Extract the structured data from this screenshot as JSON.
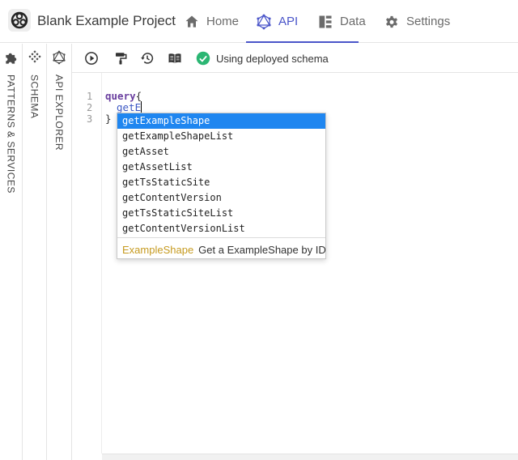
{
  "header": {
    "project_title": "Blank Example Project",
    "nav": [
      {
        "label": "Home",
        "icon": "home-icon"
      },
      {
        "label": "API",
        "icon": "graphql-icon",
        "active": true
      },
      {
        "label": "Data",
        "icon": "data-icon"
      },
      {
        "label": "Settings",
        "icon": "gear-icon"
      }
    ]
  },
  "sidebar": {
    "panels": [
      {
        "label": "PATTERNS & SERVICES",
        "icon": "puzzle-icon"
      },
      {
        "label": "SCHEMA",
        "icon": "schema-icon"
      },
      {
        "label": "API EXPLORER",
        "icon": "explorer-icon"
      }
    ]
  },
  "toolbar": {
    "status_text": "Using deployed schema"
  },
  "editor": {
    "line_numbers": [
      "1",
      "2",
      "3"
    ],
    "line1_keyword": "query",
    "line1_brace": "{",
    "line2_text": "getE",
    "line3_text": "}"
  },
  "autocomplete": {
    "items": [
      "getExampleShape",
      "getExampleShapeList",
      "getAsset",
      "getAssetList",
      "getTsStaticSite",
      "getContentVersion",
      "getTsStaticSiteList",
      "getContentVersionList"
    ],
    "detail_type": "ExampleShape",
    "detail_desc": "Get a ExampleShape by ID"
  },
  "colors": {
    "accent": "#4a55c9",
    "selection": "#1f86f0",
    "status_ok": "#2bb673",
    "type_color": "#c69a1f"
  }
}
